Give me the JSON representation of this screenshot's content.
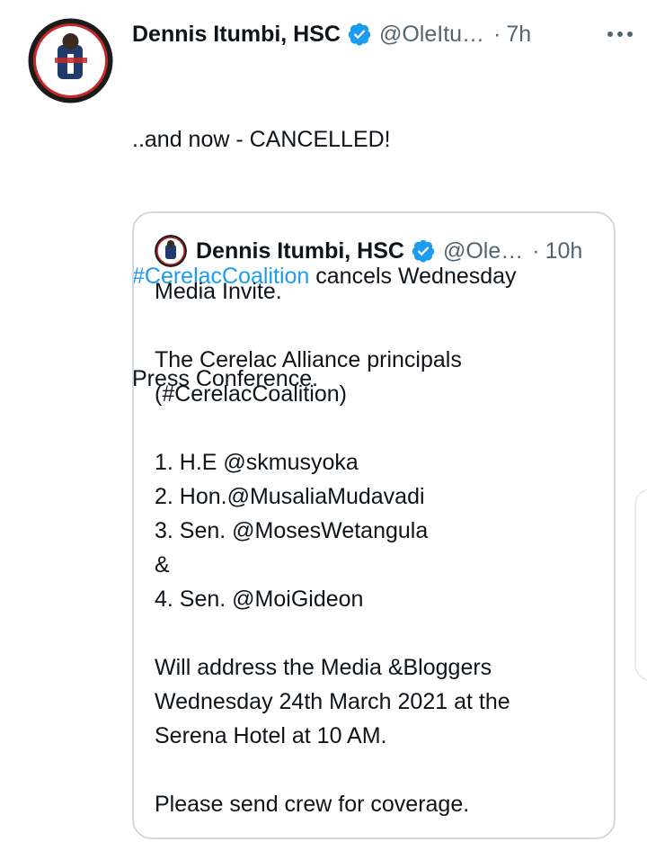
{
  "tweet": {
    "author_name": "Dennis Itumbi, HSC",
    "handle": "@OleItu…",
    "separator": "·",
    "time": "7h",
    "line1": "..and now - CANCELLED!",
    "hashtag": "#CerelacCoalition",
    "line2_rest": " cancels Wednesday",
    "line3": "Press Conference.",
    "avatar_text_top": "I'VE GOT",
    "avatar_text_bottom": "YOUR BACK"
  },
  "quoted": {
    "author_name": "Dennis Itumbi, HSC",
    "handle": "@Ole…",
    "separator": "·",
    "time": "10h",
    "lines": [
      "Media Invite.",
      "",
      "The Cerelac Alliance principals",
      "(#CerelacCoalition)",
      "",
      "1. H.E @skmusyoka",
      "2. Hon.@MusaliaMudavadi",
      "3. Sen. @MosesWetangula",
      "&",
      "4. Sen. @MoiGideon",
      "",
      "Will address the Media &Bloggers",
      "Wednesday 24th March 2021 at the",
      "Serena Hotel at 10 AM.",
      "",
      "Please send crew for coverage."
    ]
  },
  "icons": {
    "verified": "verified-badge-icon",
    "more": "more-options-icon"
  },
  "colors": {
    "text": "#0f1419",
    "secondary": "#536471",
    "link": "#1d9bf0",
    "border": "#cfd9de"
  }
}
